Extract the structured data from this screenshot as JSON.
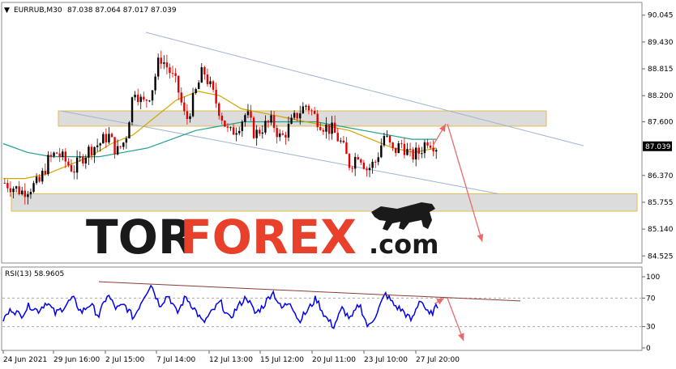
{
  "header": {
    "arrow_glyph": "▼",
    "symbol": "EURRUB,M30",
    "ohlc": "87.038 87.064 87.017 87.039"
  },
  "price_axis": {
    "ticks": [
      "90.045",
      "89.430",
      "88.815",
      "88.200",
      "87.600",
      "86.370",
      "85.755",
      "85.140",
      "84.525"
    ],
    "current": "87.039"
  },
  "rsi": {
    "label": "RSI(13) 58.9605",
    "ticks": [
      "100",
      "70",
      "30",
      "0"
    ]
  },
  "time_axis": {
    "ticks": [
      "24 Jun 2021",
      "29 Jun 16:00",
      "2 Jul 15:00",
      "7 Jul 14:00",
      "12 Jul 13:00",
      "15 Jul 12:00",
      "20 Jul 11:00",
      "23 Jul 10:00",
      "27 Jul 20:00"
    ]
  },
  "watermark": {
    "part1": "TOR",
    "part2": "FOREX",
    "part3": ".com"
  },
  "colors": {
    "bull": "#000000",
    "bear": "#e00000",
    "ma_fast": "#d4a400",
    "ma_slow": "#20a090",
    "channel": "#9fb4cf",
    "zone_fill": "#d6d6d6",
    "zone_border": "#e0b030",
    "arrow": "#e86a6a",
    "rsi_line": "#0000ee",
    "rsi_trend": "#8b3a3a",
    "watermark_dark": "#1a1a1a",
    "watermark_red": "#e8402a"
  },
  "chart_data": {
    "type": "candlestick",
    "symbol": "EURRUB",
    "timeframe": "M30",
    "x_ticks": [
      "24 Jun 2021",
      "29 Jun 16:00",
      "2 Jul 15:00",
      "7 Jul 14:00",
      "12 Jul 13:00",
      "15 Jul 12:00",
      "20 Jul 11:00",
      "23 Jul 10:00",
      "27 Jul 20:00"
    ],
    "ylim": [
      84.4,
      90.3
    ],
    "close_path": [
      86.2,
      86.1,
      86.0,
      86.1,
      86.2,
      86.7,
      86.9,
      86.7,
      86.5,
      86.8,
      87.0,
      87.1,
      87.3,
      86.9,
      87.2,
      88.4,
      88.0,
      88.3,
      89.1,
      88.8,
      88.4,
      87.6,
      88.2,
      88.8,
      88.3,
      87.8,
      87.3,
      87.5,
      87.8,
      87.3,
      87.5,
      87.6,
      87.2,
      87.5,
      87.8,
      88.0,
      87.7,
      87.5,
      87.4,
      87.1,
      86.6,
      86.9,
      86.5,
      86.7,
      87.3,
      86.9,
      87.1,
      86.8,
      86.9,
      87.2,
      87.04
    ],
    "ma_fast": [
      86.3,
      86.3,
      86.4,
      86.6,
      86.8,
      87.1,
      87.3,
      87.7,
      88.1,
      88.3,
      88.2,
      87.9,
      87.8,
      87.7,
      87.6,
      87.5,
      87.4,
      87.2,
      87.0,
      86.9,
      87.0
    ],
    "ma_slow": [
      87.1,
      86.9,
      86.8,
      86.8,
      86.8,
      86.9,
      87.0,
      87.2,
      87.4,
      87.5,
      87.6,
      87.6,
      87.6,
      87.6,
      87.5,
      87.4,
      87.3,
      87.2,
      87.2
    ],
    "rsi": {
      "period": 13,
      "current": 58.9605,
      "ylim": [
        0,
        100
      ],
      "levels": [
        70,
        30
      ],
      "path": [
        40,
        55,
        45,
        60,
        52,
        65,
        48,
        58,
        70,
        50,
        62,
        45,
        75,
        55,
        60,
        42,
        68,
        90,
        60,
        75,
        48,
        72,
        55,
        35,
        50,
        65,
        40,
        58,
        72,
        48,
        60,
        80,
        55,
        66,
        38,
        52,
        70,
        45,
        30,
        55,
        40,
        62,
        28,
        50,
        76,
        60,
        52,
        38,
        70,
        45,
        59
      ]
    },
    "annotations": {
      "resistance_zone": [
        87.5,
        87.85
      ],
      "support_zone": [
        85.55,
        85.95
      ],
      "channel_lines": 2
    }
  }
}
